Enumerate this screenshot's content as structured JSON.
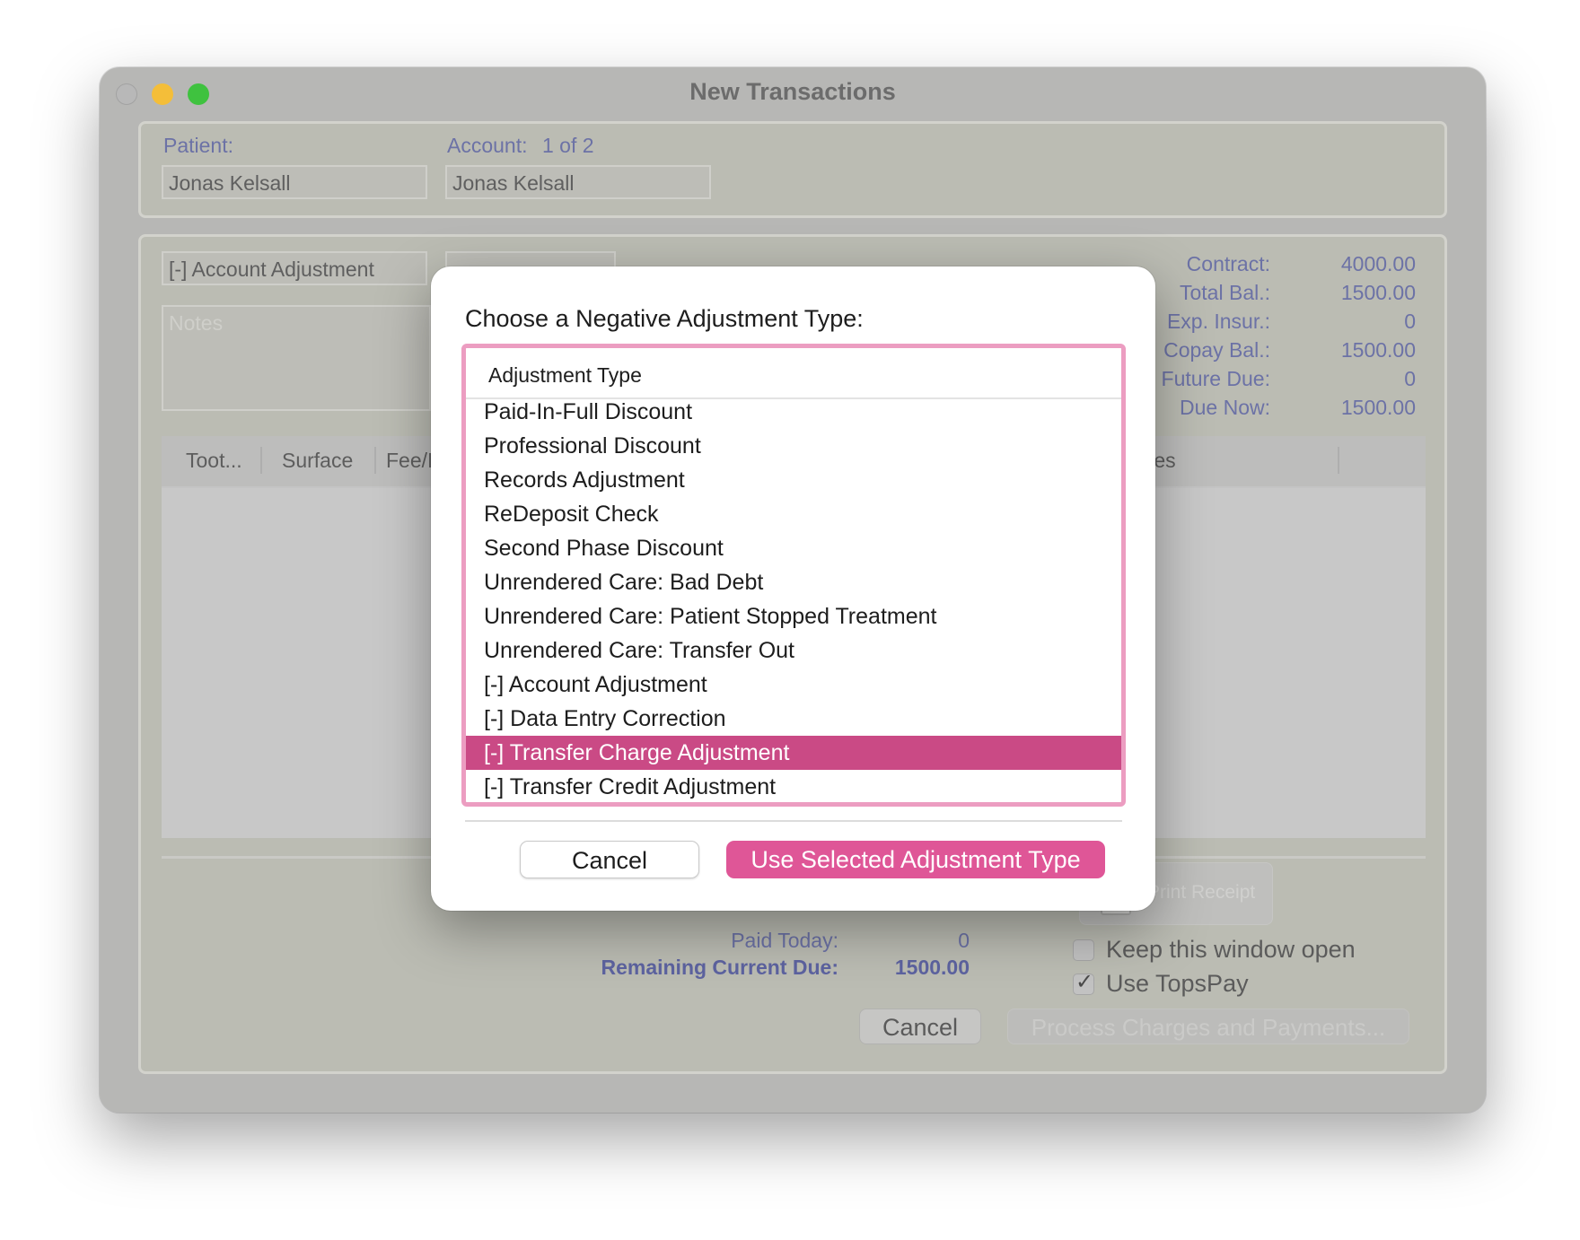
{
  "window": {
    "title": "New Transactions"
  },
  "header": {
    "patient_label": "Patient:",
    "patient_value": "Jonas Kelsall",
    "account_label": "Account:",
    "account_count": "1 of 2",
    "account_value": "Jonas Kelsall"
  },
  "transaction": {
    "type_value": "[-] Account Adjustment",
    "notes_placeholder": "Notes"
  },
  "summary": [
    {
      "label": "Contract:",
      "value": "4000.00"
    },
    {
      "label": "Total Bal.:",
      "value": "1500.00"
    },
    {
      "label": "Exp. Insur.:",
      "value": "0"
    },
    {
      "label": "Copay Bal.:",
      "value": "1500.00"
    },
    {
      "label": "Future Due:",
      "value": "0"
    },
    {
      "label": "Due Now:",
      "value": "1500.00"
    }
  ],
  "table": {
    "columns": [
      "Toot...",
      "Surface",
      "Fee/I",
      "tes"
    ]
  },
  "totals": {
    "paid_today_label": "Paid Today:",
    "paid_today_value": "0",
    "remaining_label": "Remaining Current Due:",
    "remaining_value": "1500.00"
  },
  "options": {
    "keep_open_label": "Keep this window open",
    "keep_open_checked": false,
    "topspay_label": "Use TopsPay",
    "topspay_checked": true
  },
  "buttons": {
    "print_receipt": "Print Receipt",
    "cancel": "Cancel",
    "process": "Process Charges and Payments..."
  },
  "modal": {
    "title": "Choose a Negative Adjustment Type:",
    "list_header": "Adjustment Type",
    "items": [
      "Paid-In-Full Discount",
      "Professional Discount",
      "Records Adjustment",
      "ReDeposit Check",
      "Second Phase Discount",
      "Unrendered Care: Bad Debt",
      "Unrendered Care: Patient Stopped Treatment",
      "Unrendered Care: Transfer Out",
      "[-] Account Adjustment",
      "[-] Data Entry Correction",
      "[-] Transfer Charge Adjustment",
      "[-] Transfer Credit Adjustment"
    ],
    "selected_item": "[-] Transfer Charge Adjustment",
    "cancel_label": "Cancel",
    "use_label": "Use Selected Adjustment Type"
  },
  "colors": {
    "accent": "#df5697",
    "selection": "#ca4a85",
    "list_border": "#ec9dc1",
    "label_blue": "#6c72a6"
  }
}
